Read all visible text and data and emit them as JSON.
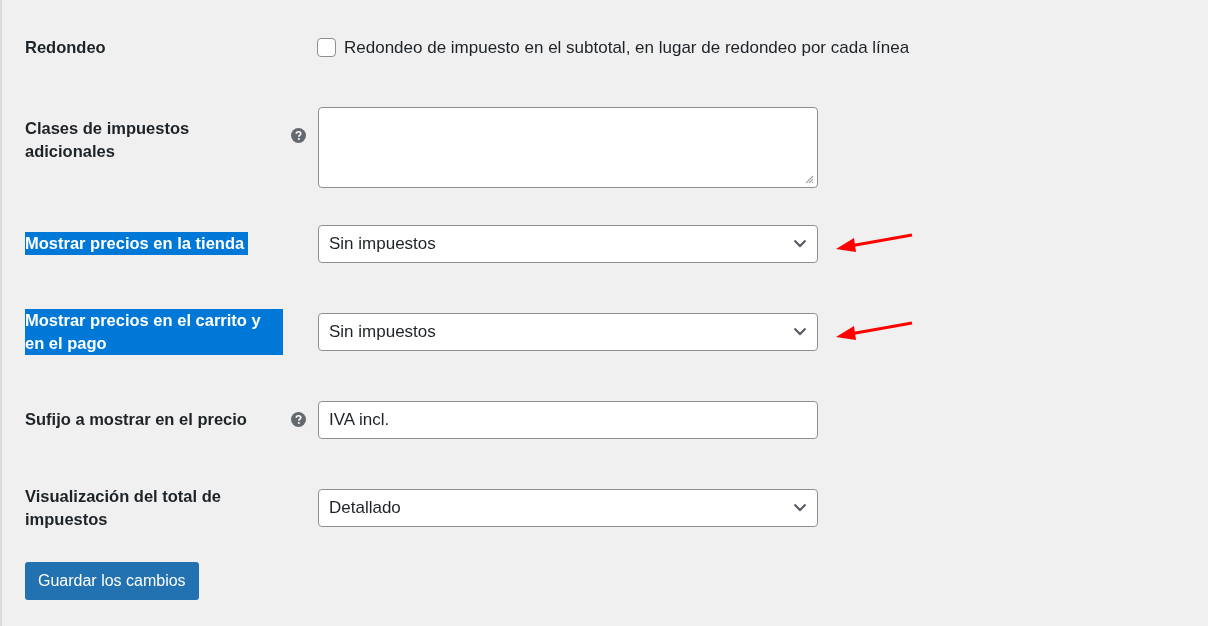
{
  "rows": [
    {
      "label": "Redondeo",
      "kind": "checkbox",
      "help": false,
      "highlighted": false,
      "marked": false,
      "checked": false,
      "text": "Redondeo de impuesto en el subtotal, en lugar de redondeo por cada línea"
    },
    {
      "label": "Clases de impuestos adicionales",
      "kind": "textarea",
      "help": true,
      "highlighted": false,
      "marked": false
    },
    {
      "label": "Mostrar precios en la tienda",
      "kind": "select",
      "help": false,
      "highlighted": true,
      "marked": true,
      "value": "Sin impuestos"
    },
    {
      "label": "Mostrar precios en el carrito y en el pago",
      "kind": "select",
      "help": false,
      "highlighted": true,
      "marked": true,
      "value": "Sin impuestos"
    },
    {
      "label": "Sufijo a mostrar en el precio",
      "kind": "text",
      "help": true,
      "highlighted": false,
      "marked": false,
      "value": "IVA incl."
    },
    {
      "label": "Visualización del total de impuestos",
      "kind": "select",
      "help": false,
      "highlighted": false,
      "marked": false,
      "value": "Detallado"
    }
  ],
  "save_button": "Guardar los cambios"
}
